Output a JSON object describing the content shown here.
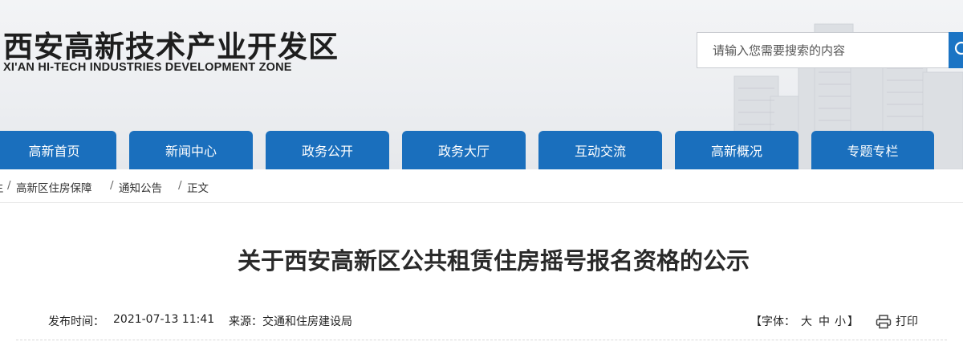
{
  "header": {
    "logo_cn": "西安高新技术产业开发区",
    "logo_en": "XI'AN HI-TECH INDUSTRIES DEVELOPMENT ZONE"
  },
  "search": {
    "placeholder": "请输入您需要搜索的内容",
    "icon": "search-icon"
  },
  "nav": {
    "items": [
      {
        "label": "高新首页"
      },
      {
        "label": "新闻中心"
      },
      {
        "label": "政务公开"
      },
      {
        "label": "政务大厅"
      },
      {
        "label": "互动交流"
      },
      {
        "label": "高新概况"
      },
      {
        "label": "专题专栏"
      }
    ]
  },
  "breadcrumb": {
    "items": [
      "主",
      "高新区住房保障",
      "通知公告",
      "正文"
    ],
    "separator": "/"
  },
  "article": {
    "title": "关于西安高新区公共租赁住房摇号报名资格的公示",
    "publish_label": "发布时间：",
    "publish_time": "2021-07-13 11:41",
    "source_label": "来源：",
    "source": "交通和住房建设局",
    "font_open": "【字体：",
    "font_large": "大",
    "font_medium": "中",
    "font_small": "小",
    "font_close": "】",
    "print_label": "打印",
    "print_icon": "printer-icon"
  },
  "colors": {
    "nav_blue": "#1a6fbd",
    "search_blue": "#1b74c4"
  }
}
